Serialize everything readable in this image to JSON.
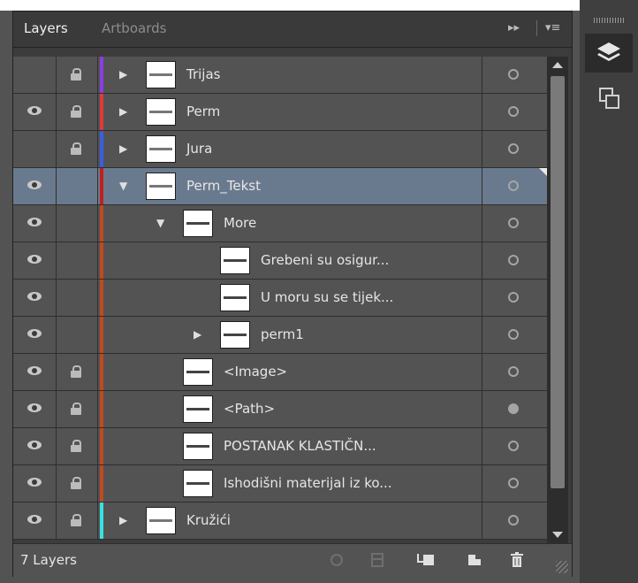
{
  "tabs": [
    {
      "label": "Layers",
      "active": true
    },
    {
      "label": "Artboards",
      "active": false
    }
  ],
  "toolbar_icons": [
    "fast-forward-icon",
    "panel-menu-icon"
  ],
  "layers": [
    {
      "name": "Trijas",
      "visible": false,
      "locked": true,
      "color": "#8a3ee0",
      "expanded": false,
      "has_children": true,
      "indent": 0,
      "target": "hollow",
      "selected": false
    },
    {
      "name": "Perm",
      "visible": true,
      "locked": true,
      "color": "#e03a3a",
      "expanded": false,
      "has_children": true,
      "indent": 0,
      "target": "hollow",
      "selected": false
    },
    {
      "name": "Jura",
      "visible": false,
      "locked": true,
      "color": "#3a5ee0",
      "expanded": false,
      "has_children": true,
      "indent": 0,
      "target": "hollow",
      "selected": false
    },
    {
      "name": "Perm_Tekst",
      "visible": true,
      "locked": false,
      "color": "#c0201e",
      "expanded": true,
      "has_children": true,
      "indent": 0,
      "target": "hollow",
      "selected": true
    },
    {
      "name": "More",
      "visible": true,
      "locked": false,
      "color": "#c04a20",
      "expanded": true,
      "has_children": true,
      "indent": 1,
      "target": "hollow",
      "selected": false
    },
    {
      "name": "Grebeni su osigur...",
      "visible": true,
      "locked": false,
      "color": "#c04a20",
      "expanded": false,
      "has_children": false,
      "indent": 2,
      "target": "hollow",
      "selected": false
    },
    {
      "name": "U moru su se tijek...",
      "visible": true,
      "locked": false,
      "color": "#c04a20",
      "expanded": false,
      "has_children": false,
      "indent": 2,
      "target": "hollow",
      "selected": false
    },
    {
      "name": "perm1",
      "visible": true,
      "locked": false,
      "color": "#c04a20",
      "expanded": false,
      "has_children": true,
      "indent": 2,
      "target": "hollow",
      "selected": false
    },
    {
      "name": "<Image>",
      "visible": true,
      "locked": true,
      "color": "#c04a20",
      "expanded": false,
      "has_children": false,
      "indent": 1,
      "target": "hollow",
      "selected": false
    },
    {
      "name": "<Path>",
      "visible": true,
      "locked": true,
      "color": "#c04a20",
      "expanded": false,
      "has_children": false,
      "indent": 1,
      "target": "filled",
      "selected": false
    },
    {
      "name": "POSTANAK KLASTIČN...",
      "visible": true,
      "locked": true,
      "color": "#c04a20",
      "expanded": false,
      "has_children": false,
      "indent": 1,
      "target": "hollow",
      "selected": false
    },
    {
      "name": "Ishodišni materijal iz ko...",
      "visible": true,
      "locked": true,
      "color": "#c04a20",
      "expanded": false,
      "has_children": false,
      "indent": 1,
      "target": "hollow",
      "selected": false
    },
    {
      "name": "Kružići",
      "visible": true,
      "locked": true,
      "color": "#3ae0e0",
      "expanded": false,
      "has_children": true,
      "indent": 0,
      "target": "hollow",
      "selected": false
    }
  ],
  "status": {
    "layer_count": "7 Layers"
  },
  "bottom_icons": [
    "locate-object-icon",
    "make-clipping-mask-icon",
    "create-sublayer-icon",
    "create-new-layer-icon",
    "delete-icon"
  ],
  "side_dock": [
    "layers-panel-icon",
    "artboards-panel-icon"
  ]
}
